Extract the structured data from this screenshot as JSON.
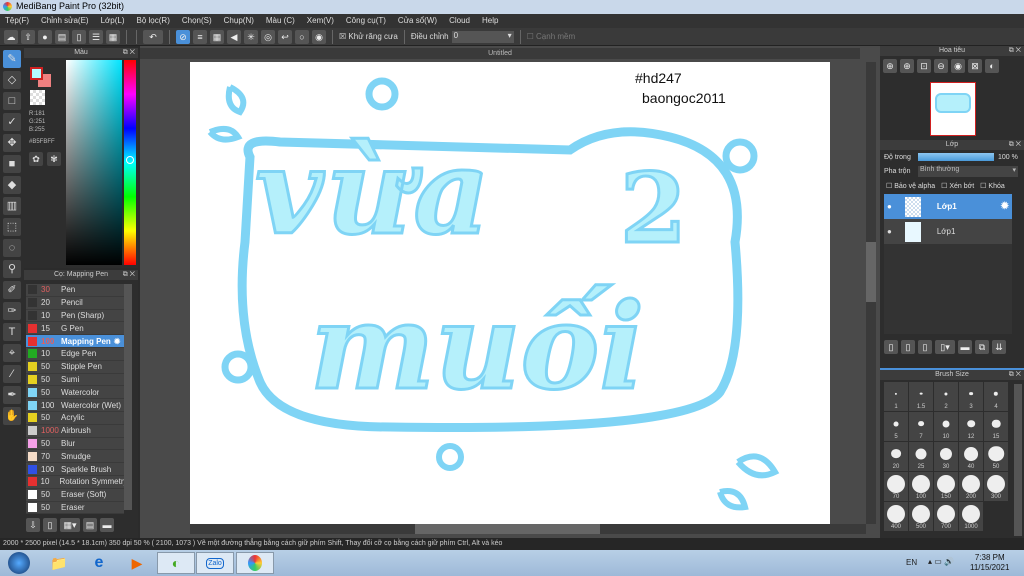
{
  "app": {
    "title": "MediBang Paint Pro (32bit)"
  },
  "menu": [
    "Tệp(F)",
    "Chỉnh sửa(E)",
    "Lớp(L)",
    "Bộ lọc(R)",
    "Chọn(S)",
    "Chụp(N)",
    "Màu (C)",
    "Xem(V)",
    "Công cụ(T)",
    "Cửa sổ(W)",
    "Cloud",
    "Help"
  ],
  "toolbar": {
    "antialias_label": "Khử răng cưa",
    "correction_label": "Điều chỉnh",
    "correction_value": "0",
    "smooth_label": "Cạnh mềm"
  },
  "color_panel": {
    "title": "Màu",
    "r": "R:181",
    "g": "G:251",
    "b": "B:255",
    "hex": "#B5FBFF",
    "fg": "#b5fbff",
    "bg": "#f08080"
  },
  "brush_panel": {
    "title": "Cọ: Mapping Pen",
    "brushes": [
      {
        "size": "30",
        "name": "Pen",
        "color": "#333333"
      },
      {
        "size": "20",
        "name": "Pencil",
        "color": "#333333"
      },
      {
        "size": "10",
        "name": "Pen (Sharp)",
        "color": "#333333"
      },
      {
        "size": "15",
        "name": "G Pen",
        "color": "#e53030"
      },
      {
        "size": "100",
        "name": "Mapping Pen",
        "color": "#e53030"
      },
      {
        "size": "10",
        "name": "Edge Pen",
        "color": "#22aa22"
      },
      {
        "size": "50",
        "name": "Stipple Pen",
        "color": "#e5d020"
      },
      {
        "size": "50",
        "name": "Sumi",
        "color": "#e5d020"
      },
      {
        "size": "50",
        "name": "Watercolor",
        "color": "#7fd4f5"
      },
      {
        "size": "100",
        "name": "Watercolor (Wet)",
        "color": "#7fd4f5"
      },
      {
        "size": "50",
        "name": "Acrylic",
        "color": "#e5d020"
      },
      {
        "size": "1000",
        "name": "Airbrush",
        "color": "#cccccc"
      },
      {
        "size": "50",
        "name": "Blur",
        "color": "#f5a0e8"
      },
      {
        "size": "70",
        "name": "Smudge",
        "color": "#f5dcc8"
      },
      {
        "size": "100",
        "name": "Sparkle Brush",
        "color": "#3050e5"
      },
      {
        "size": "10",
        "name": "Rotation Symmetry",
        "color": "#e53030"
      },
      {
        "size": "50",
        "name": "Eraser (Soft)",
        "color": "#ffffff"
      },
      {
        "size": "50",
        "name": "Eraser",
        "color": "#ffffff"
      }
    ]
  },
  "document": {
    "tab": "Untitled",
    "tag1": "#hd247",
    "tag2": "baongoc2011",
    "line1": "vừa",
    "num": "2",
    "line2": "muối"
  },
  "navigator": {
    "title": "Hoa tiêu"
  },
  "layers": {
    "title": "Lớp",
    "opacity_label": "Độ trong",
    "opacity_value": "100 %",
    "opacity": 100,
    "blend_label": "Pha trộn",
    "blend_value": "Bình thường",
    "protect_alpha": "Bảo vệ alpha",
    "clipping": "Xén bớt",
    "lock": "Khóa",
    "items": [
      {
        "name": "Lớp1",
        "selected": true
      },
      {
        "name": "Lớp1",
        "selected": false
      }
    ]
  },
  "brush_size": {
    "title": "Brush Size",
    "sizes": [
      "1",
      "1.5",
      "2",
      "3",
      "4",
      "5",
      "7",
      "10",
      "12",
      "15",
      "20",
      "25",
      "30",
      "40",
      "50",
      "70",
      "100",
      "150",
      "200",
      "300",
      "400",
      "500",
      "700",
      "1000"
    ]
  },
  "status": "2000 * 2500 pixel   (14.5 * 18.1cm)   350 dpi   50 %   ( 2100, 1073 )  Vẽ một đường thẳng bằng cách giữ phím Shift, Thay đổi cỡ cọ bằng cách giữ phím Ctrl, Alt và kéo",
  "taskbar": {
    "lang": "EN",
    "time": "7:38 PM",
    "date": "11/15/2021",
    "zalo": "Zalo"
  }
}
